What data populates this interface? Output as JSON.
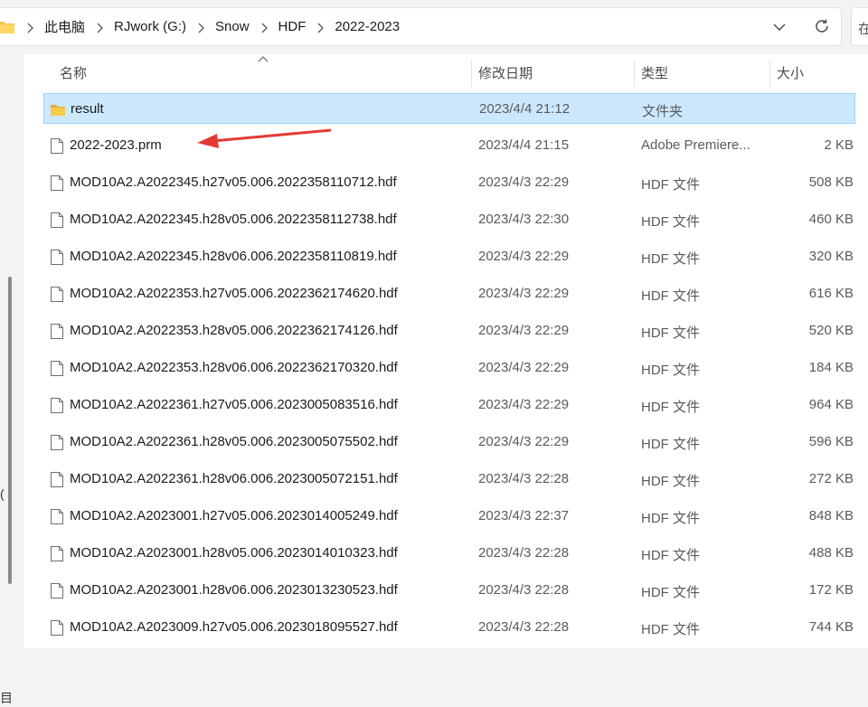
{
  "address_bar": {
    "crumbs": [
      "此电脑",
      "RJwork (G:)",
      "Snow",
      "HDF",
      "2022-2023"
    ],
    "search_partial": "在"
  },
  "nav_fragments": [
    "(",
    "目"
  ],
  "columns": {
    "name": "名称",
    "date": "修改日期",
    "type": "类型",
    "size": "大小"
  },
  "files": [
    {
      "name": "result",
      "date": "2023/4/4 21:12",
      "type": "文件夹",
      "size": "",
      "icon": "folder-icon",
      "selected": true
    },
    {
      "name": "2022-2023.prm",
      "date": "2023/4/4 21:15",
      "type": "Adobe Premiere...",
      "size": "2 KB",
      "icon": "file-icon"
    },
    {
      "name": "MOD10A2.A2022345.h27v05.006.2022358110712.hdf",
      "date": "2023/4/3 22:29",
      "type": "HDF 文件",
      "size": "508 KB",
      "icon": "file-icon"
    },
    {
      "name": "MOD10A2.A2022345.h28v05.006.2022358112738.hdf",
      "date": "2023/4/3 22:30",
      "type": "HDF 文件",
      "size": "460 KB",
      "icon": "file-icon"
    },
    {
      "name": "MOD10A2.A2022345.h28v06.006.2022358110819.hdf",
      "date": "2023/4/3 22:29",
      "type": "HDF 文件",
      "size": "320 KB",
      "icon": "file-icon"
    },
    {
      "name": "MOD10A2.A2022353.h27v05.006.2022362174620.hdf",
      "date": "2023/4/3 22:29",
      "type": "HDF 文件",
      "size": "616 KB",
      "icon": "file-icon"
    },
    {
      "name": "MOD10A2.A2022353.h28v05.006.2022362174126.hdf",
      "date": "2023/4/3 22:29",
      "type": "HDF 文件",
      "size": "520 KB",
      "icon": "file-icon"
    },
    {
      "name": "MOD10A2.A2022353.h28v06.006.2022362170320.hdf",
      "date": "2023/4/3 22:29",
      "type": "HDF 文件",
      "size": "184 KB",
      "icon": "file-icon"
    },
    {
      "name": "MOD10A2.A2022361.h27v05.006.2023005083516.hdf",
      "date": "2023/4/3 22:29",
      "type": "HDF 文件",
      "size": "964 KB",
      "icon": "file-icon"
    },
    {
      "name": "MOD10A2.A2022361.h28v05.006.2023005075502.hdf",
      "date": "2023/4/3 22:29",
      "type": "HDF 文件",
      "size": "596 KB",
      "icon": "file-icon"
    },
    {
      "name": "MOD10A2.A2022361.h28v06.006.2023005072151.hdf",
      "date": "2023/4/3 22:28",
      "type": "HDF 文件",
      "size": "272 KB",
      "icon": "file-icon"
    },
    {
      "name": "MOD10A2.A2023001.h27v05.006.2023014005249.hdf",
      "date": "2023/4/3 22:37",
      "type": "HDF 文件",
      "size": "848 KB",
      "icon": "file-icon"
    },
    {
      "name": "MOD10A2.A2023001.h28v05.006.2023014010323.hdf",
      "date": "2023/4/3 22:28",
      "type": "HDF 文件",
      "size": "488 KB",
      "icon": "file-icon"
    },
    {
      "name": "MOD10A2.A2023001.h28v06.006.2023013230523.hdf",
      "date": "2023/4/3 22:28",
      "type": "HDF 文件",
      "size": "172 KB",
      "icon": "file-icon"
    },
    {
      "name": "MOD10A2.A2023009.h27v05.006.2023018095527.hdf",
      "date": "2023/4/3 22:28",
      "type": "HDF 文件",
      "size": "744 KB",
      "icon": "file-icon"
    }
  ],
  "colors": {
    "selection_bg": "#cce8ff",
    "selection_border": "#99d1ff",
    "folder": "#f5c242",
    "annotation_arrow": "#e53935"
  }
}
